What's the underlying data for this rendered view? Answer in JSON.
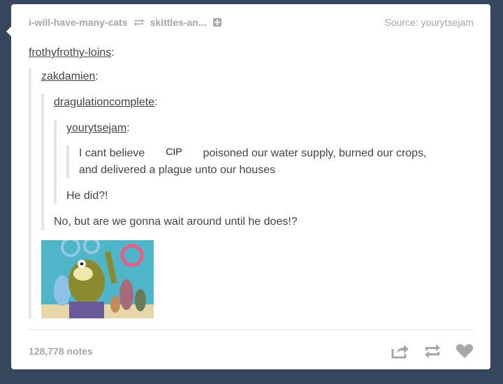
{
  "post": {
    "header": {
      "reblogger": "i-will-have-many-cats",
      "reblogged_from": "skittles-an...",
      "source_prefix": "Source:",
      "source_name": "yourytsejam"
    },
    "thread": {
      "level0_user": "frothyfrothy-loins",
      "level1_user": "zakdamien",
      "level2_user": "dragulationcomplete",
      "level3_user": "yourytsejam",
      "level4_text_a": "I cant believe",
      "level4_label": "CIP",
      "level4_text_b": "poisoned our water supply, burned our crops,",
      "level4_text_c": "and delivered a plague unto our houses",
      "level3_reply": "He did?!",
      "level2_reply": "No, but are we gonna wait around until he does!?"
    },
    "footer": {
      "notes": "128,778 notes"
    }
  },
  "colors": {
    "background": "#36465d",
    "card": "#ffffff",
    "muted": "#a7a7a7",
    "text": "#444444",
    "quote_border": "#e6e6e6"
  },
  "icons": [
    "reblog-icon",
    "add-icon",
    "share-icon",
    "heart-icon"
  ]
}
